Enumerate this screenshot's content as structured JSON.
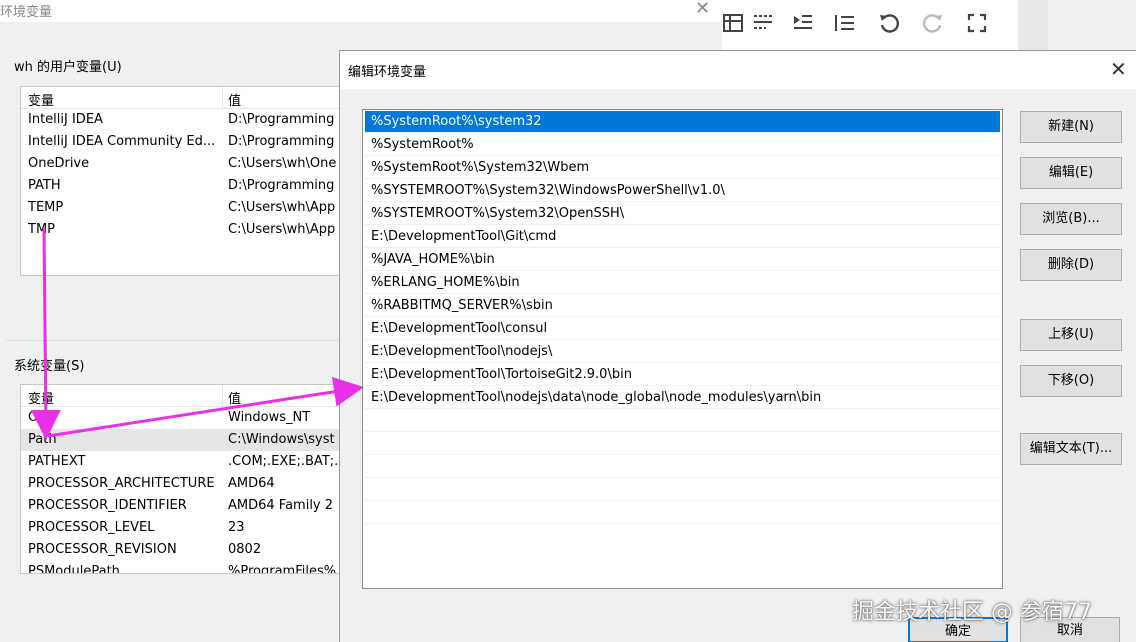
{
  "background_window": {
    "title": "环境变量",
    "close_glyph": "✕",
    "user_vars": {
      "label": "wh 的用户变量(U)",
      "col_var": "变量",
      "col_val": "值",
      "rows": [
        {
          "name": "IntelliJ IDEA",
          "value": "D:\\Programming"
        },
        {
          "name": "IntelliJ IDEA Community Ed...",
          "value": "D:\\Programming"
        },
        {
          "name": "OneDrive",
          "value": "C:\\Users\\wh\\One"
        },
        {
          "name": "PATH",
          "value": "D:\\Programming"
        },
        {
          "name": "TEMP",
          "value": "C:\\Users\\wh\\App"
        },
        {
          "name": "TMP",
          "value": "C:\\Users\\wh\\App"
        }
      ]
    },
    "system_vars": {
      "label": "系统变量(S)",
      "col_var": "变量",
      "col_val": "值",
      "rows": [
        {
          "name": "OS",
          "value": "Windows_NT"
        },
        {
          "name": "Path",
          "value": "C:\\Windows\\syst"
        },
        {
          "name": "PATHEXT",
          "value": ".COM;.EXE;.BAT;."
        },
        {
          "name": "PROCESSOR_ARCHITECTURE",
          "value": "AMD64"
        },
        {
          "name": "PROCESSOR_IDENTIFIER",
          "value": "AMD64 Family 2"
        },
        {
          "name": "PROCESSOR_LEVEL",
          "value": "23"
        },
        {
          "name": "PROCESSOR_REVISION",
          "value": "0802"
        },
        {
          "name": "PSModulePath",
          "value": "%ProgramFiles%"
        }
      ]
    }
  },
  "toolbar": {
    "icons": [
      "table-icon",
      "text-wrap-icon",
      "indent-icon",
      "list-icon",
      "undo-icon",
      "redo-icon",
      "fullscreen-icon"
    ]
  },
  "dialog": {
    "title": "编辑环境变量",
    "close_glyph": "✕",
    "paths": [
      "%SystemRoot%\\system32",
      "%SystemRoot%",
      "%SystemRoot%\\System32\\Wbem",
      "%SYSTEMROOT%\\System32\\WindowsPowerShell\\v1.0\\",
      "%SYSTEMROOT%\\System32\\OpenSSH\\",
      "E:\\DevelopmentTool\\Git\\cmd",
      "%JAVA_HOME%\\bin",
      "%ERLANG_HOME%\\bin",
      "%RABBITMQ_SERVER%\\sbin",
      "E:\\DevelopmentTool\\consul",
      "E:\\DevelopmentTool\\nodejs\\",
      "E:\\DevelopmentTool\\TortoiseGit2.9.0\\bin",
      "E:\\DevelopmentTool\\nodejs\\data\\node_global\\node_modules\\yarn\\bin"
    ],
    "selected_index": 0,
    "buttons": {
      "new": "新建(N)",
      "edit": "编辑(E)",
      "browse": "浏览(B)...",
      "delete": "删除(D)",
      "move_up": "上移(U)",
      "move_down": "下移(O)",
      "edit_text": "编辑文本(T)...",
      "ok": "确定",
      "cancel": "取消"
    }
  },
  "watermark": "掘金技术社区 @ 参宿77",
  "colors": {
    "selection": "#0078d7",
    "arrow": "#e830e8"
  }
}
